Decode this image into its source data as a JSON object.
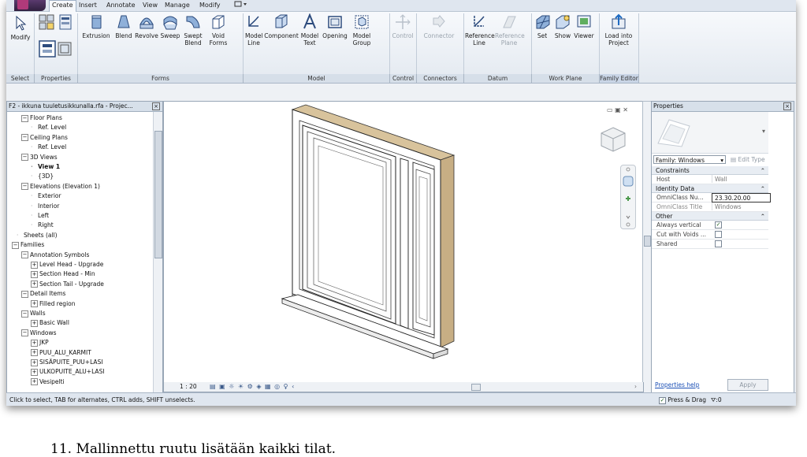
{
  "menu": {
    "tabs": [
      "Create",
      "Insert",
      "Annotate",
      "View",
      "Manage",
      "Modify"
    ],
    "active_tab": "Create"
  },
  "ribbon": {
    "select": {
      "modify": "Modify",
      "panel": "Select"
    },
    "properties_panel": "Properties",
    "forms": {
      "panel": "Forms",
      "extrusion": "Extrusion",
      "blend": "Blend",
      "revolve": "Revolve",
      "sweep": "Sweep",
      "swept_blend_1": "Swept",
      "swept_blend_2": "Blend",
      "void_forms_1": "Void",
      "void_forms_2": "Forms"
    },
    "model": {
      "panel": "Model",
      "model_line_1": "Model",
      "model_line_2": "Line",
      "component": "Component",
      "model_text_1": "Model",
      "model_text_2": "Text",
      "opening": "Opening",
      "model_group_1": "Model",
      "model_group_2": "Group"
    },
    "control": {
      "panel": "Control",
      "control": "Control"
    },
    "connectors": {
      "panel": "Connectors",
      "connector": "Connector"
    },
    "datum": {
      "panel": "Datum",
      "ref_line_1": "Reference",
      "ref_line_2": "Line",
      "ref_plane_1": "Reference",
      "ref_plane_2": "Plane"
    },
    "work_plane": {
      "panel": "Work Plane",
      "set": "Set",
      "show": "Show",
      "viewer": "Viewer"
    },
    "family_editor": {
      "panel": "Family Editor",
      "load_1": "Load into",
      "load_2": "Project"
    }
  },
  "browser": {
    "title": "F2 - ikkuna tuuletusikkunalla.rfa - Projec...",
    "items": [
      {
        "text": "Floor Plans",
        "glyph": "−"
      },
      {
        "text": "Ref. Level",
        "glyph": ""
      },
      {
        "text": "Ceiling Plans",
        "glyph": "−"
      },
      {
        "text": "Ref. Level",
        "glyph": ""
      },
      {
        "text": "3D Views",
        "glyph": "−"
      },
      {
        "text": "View 1",
        "glyph": ""
      },
      {
        "text": "{3D}",
        "glyph": ""
      },
      {
        "text": "Elevations (Elevation 1)",
        "glyph": "−"
      },
      {
        "text": "Exterior",
        "glyph": ""
      },
      {
        "text": "Interior",
        "glyph": ""
      },
      {
        "text": "Left",
        "glyph": ""
      },
      {
        "text": "Right",
        "glyph": ""
      },
      {
        "text": "Sheets (all)",
        "glyph": ""
      },
      {
        "text": "Families",
        "glyph": "−"
      },
      {
        "text": "Annotation Symbols",
        "glyph": "−"
      },
      {
        "text": "Level Head - Upgrade",
        "glyph": "+"
      },
      {
        "text": "Section Head - Min",
        "glyph": "+"
      },
      {
        "text": "Section Tail - Upgrade",
        "glyph": "+"
      },
      {
        "text": "Detail Items",
        "glyph": "−"
      },
      {
        "text": "Filled region",
        "glyph": "+"
      },
      {
        "text": "Walls",
        "glyph": "−"
      },
      {
        "text": "Basic Wall",
        "glyph": "+"
      },
      {
        "text": "Windows",
        "glyph": "−"
      },
      {
        "text": "JKP",
        "glyph": "+"
      },
      {
        "text": "PUU_ALU_KARMIT",
        "glyph": "+"
      },
      {
        "text": "SISÄPUITE_PUU+LASI",
        "glyph": "+"
      },
      {
        "text": "ULKOPUITE_ALU+LASI",
        "glyph": "+"
      },
      {
        "text": "Vesipelti",
        "glyph": "+"
      }
    ]
  },
  "viewbar": {
    "scale": "1 : 20"
  },
  "properties": {
    "title": "Properties",
    "family_select": "Family: Windows",
    "edit_type": "Edit Type",
    "groups": {
      "constraints": "Constraints",
      "identity": "Identity Data",
      "other": "Other"
    },
    "rows": {
      "host_k": "Host",
      "host_v": "Wall",
      "omni_num_k": "OmniClass Nu...",
      "omni_num_v": "23.30.20.00",
      "omni_title_k": "OmniClass Title",
      "omni_title_v": "Windows",
      "always_vertical_k": "Always vertical",
      "cut_voids_k": "Cut with Voids ...",
      "shared_k": "Shared"
    },
    "help": "Properties help",
    "apply": "Apply"
  },
  "status": {
    "text": "Click to select, TAB for alternates, CTRL adds, SHIFT unselects.",
    "press_drag": "Press & Drag",
    "filter_count": ":0"
  },
  "caption": "11. Mallinnettu ruutu lisätään kaikki tilat.",
  "colors": {
    "wood": "#c7ae84",
    "panel_bg": "#e9edf2",
    "accent": "#1a4fb5"
  }
}
